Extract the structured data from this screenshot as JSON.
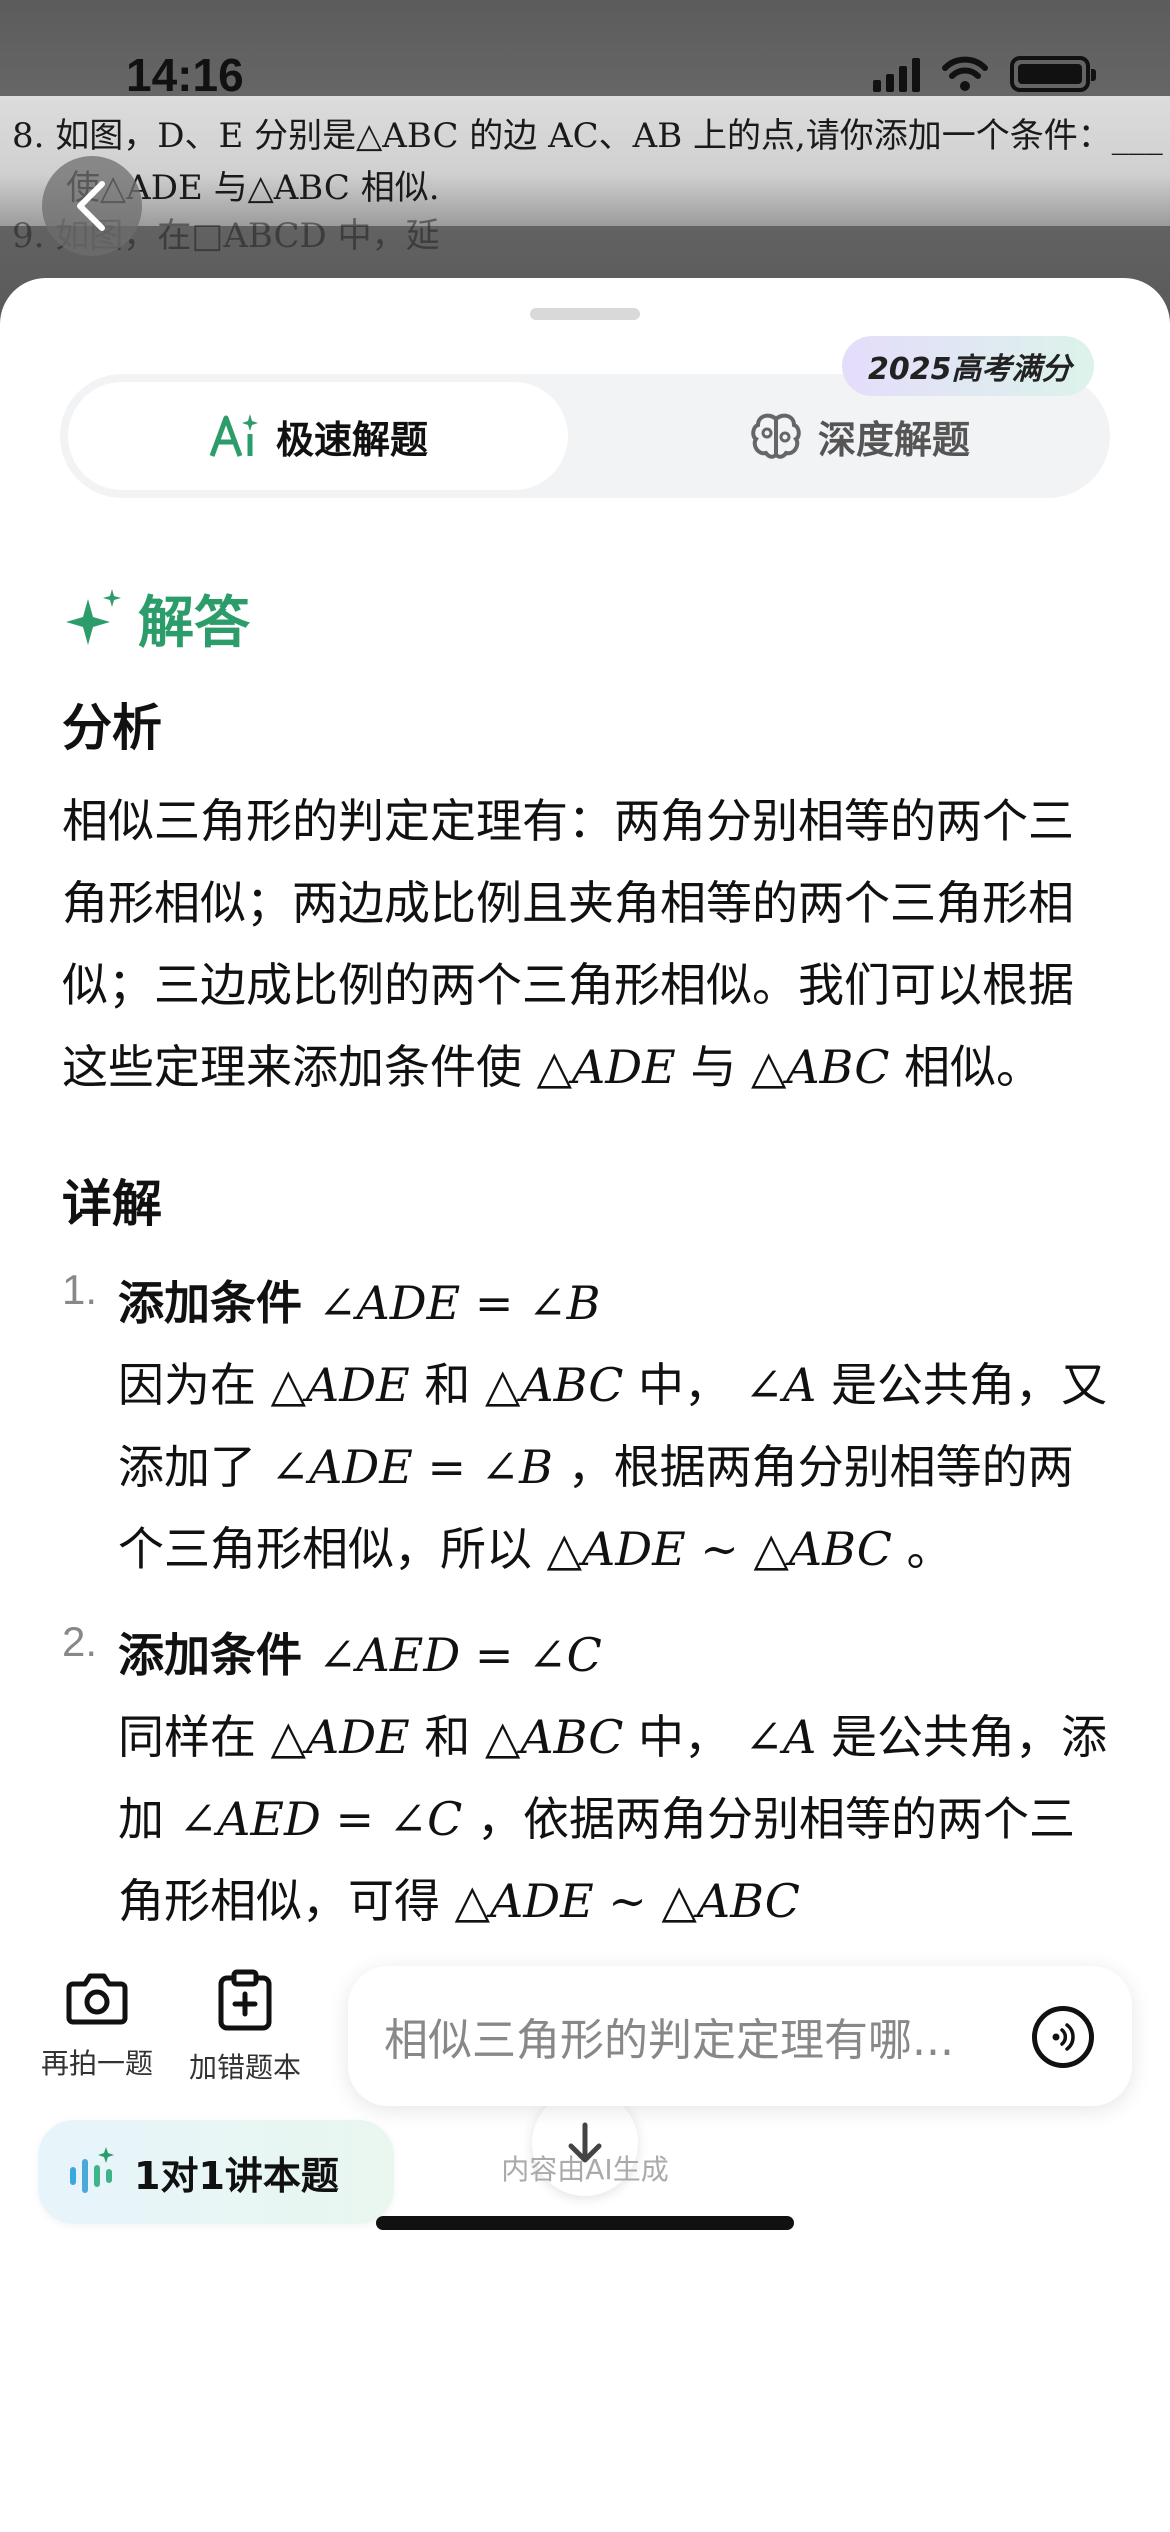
{
  "status": {
    "time": "14:16"
  },
  "photo": {
    "line1": "8. 如图，D、E 分别是△ABC 的边 AC、AB 上的点,请你添加一个条件：___",
    "line2": "使△ADE 与△ABC 相似.",
    "line3": "9. 如图，在□ABCD 中，延"
  },
  "tabs": {
    "fast_label": "极速解题",
    "deep_label": "深度解题",
    "badge": "2025高考满分"
  },
  "answer": {
    "section_title": "解答",
    "analysis_heading": "分析",
    "analysis_text_1": "相似三角形的判定定理有：两角分别相等的两个三角形相似；两边成比例且夹角相等的两个三角形相似；三边成比例的两个三角形相似。我们可以根据这些定理来添加条件使",
    "analysis_math_1": "△ADE",
    "analysis_text_2": "与",
    "analysis_math_2": "△ABC",
    "analysis_text_3": "相似。",
    "detail_heading": "详解",
    "items": [
      {
        "num": "1.",
        "title": "添加条件",
        "title_math": "∠ADE = ∠B",
        "p1": "因为在",
        "m1": "△ADE",
        "p2": "和",
        "m2": "△ABC",
        "p3": "中，",
        "m3": "∠A",
        "p4": "是公共角，又添加了",
        "m4": "∠ADE = ∠B",
        "p5": "，根据两角分别相等的两个三角形相似，所以",
        "m5": "△ADE ∼ △ABC",
        "p6": "。"
      },
      {
        "num": "2.",
        "title": "添加条件",
        "title_math": "∠AED = ∠C",
        "p1": "同样在",
        "m1": "△ADE",
        "p2": "和",
        "m2": "△ABC",
        "p3": "中，",
        "m3": "∠A",
        "p4": "是公共角，添加",
        "m4": "∠AED = ∠C",
        "p5": "，依据两角分别相等的两个三角形相似，可得",
        "m5": "△ADE ∼ △ABC",
        "p6": ""
      }
    ]
  },
  "tutor_label": "1对1讲本题",
  "toolbar": {
    "retake_label": "再拍一题",
    "wrongbook_label": "加错题本"
  },
  "ask": {
    "placeholder": "相似三角形的判定定理有哪..."
  },
  "ai_note": "内容由AI生成",
  "colors": {
    "accent": "#2d9c6b"
  }
}
